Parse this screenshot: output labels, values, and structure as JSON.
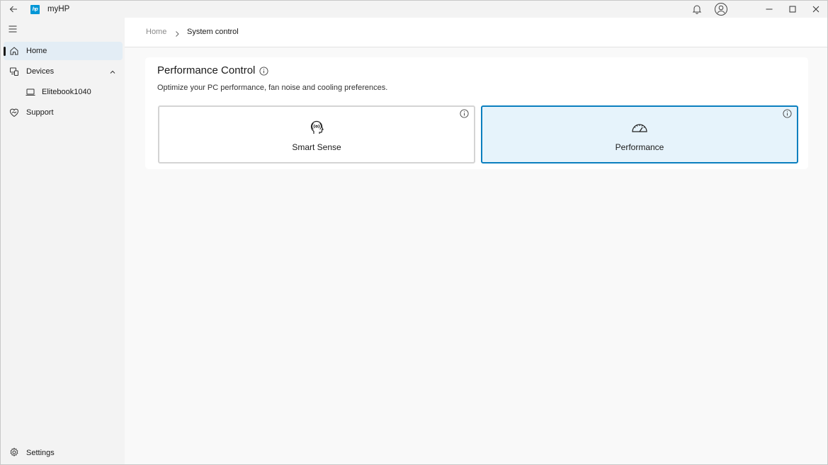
{
  "window": {
    "title": "myHP",
    "logo_text": "hp"
  },
  "sidebar": {
    "items": [
      {
        "label": "Home",
        "icon": "home-icon",
        "active": true
      },
      {
        "label": "Devices",
        "icon": "devices-icon",
        "expanded": true
      },
      {
        "label": "Elitebook1040",
        "icon": "laptop-icon"
      },
      {
        "label": "Support",
        "icon": "support-icon"
      }
    ],
    "settings_label": "Settings"
  },
  "breadcrumb": {
    "home": "Home",
    "current": "System control"
  },
  "performance_card": {
    "title": "Performance Control",
    "description": "Optimize your PC performance, fan noise and cooling preferences.",
    "modes": [
      {
        "label": "Smart Sense",
        "icon": "head-brain-icon",
        "selected": false
      },
      {
        "label": "Performance",
        "icon": "speedometer-icon",
        "selected": true
      }
    ]
  },
  "colors": {
    "accent": "#0a7fbf",
    "selected_bg": "#e6f3fb",
    "logo_blue": "#0096d6"
  }
}
